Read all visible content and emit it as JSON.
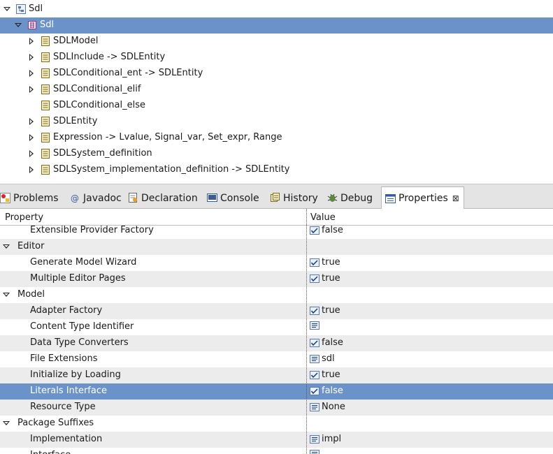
{
  "tree": {
    "items": [
      {
        "label": "Sdl",
        "icon": "genmodel-icon",
        "twisty": "open",
        "indent": 0,
        "selected": false
      },
      {
        "label": "Sdl",
        "icon": "package-icon",
        "twisty": "open",
        "indent": 1,
        "selected": true
      },
      {
        "label": "SDLModel",
        "icon": "class-icon",
        "twisty": "closed",
        "indent": 2,
        "selected": false
      },
      {
        "label": "SDLInclude -> SDLEntity",
        "icon": "class-icon",
        "twisty": "closed",
        "indent": 2,
        "selected": false
      },
      {
        "label": "SDLConditional_ent -> SDLEntity",
        "icon": "class-icon",
        "twisty": "closed",
        "indent": 2,
        "selected": false
      },
      {
        "label": "SDLConditional_elif",
        "icon": "class-icon",
        "twisty": "closed",
        "indent": 2,
        "selected": false
      },
      {
        "label": "SDLConditional_else",
        "icon": "class-icon",
        "twisty": "none",
        "indent": 2,
        "selected": false
      },
      {
        "label": "SDLEntity",
        "icon": "class-icon",
        "twisty": "closed",
        "indent": 2,
        "selected": false
      },
      {
        "label": "Expression -> Lvalue, Signal_var, Set_expr, Range",
        "icon": "class-icon",
        "twisty": "closed",
        "indent": 2,
        "selected": false
      },
      {
        "label": "SDLSystem_definition",
        "icon": "class-icon",
        "twisty": "closed",
        "indent": 2,
        "selected": false
      },
      {
        "label": "SDLSystem_implementation_definition -> SDLEntity",
        "icon": "class-icon",
        "twisty": "closed",
        "indent": 2,
        "selected": false
      }
    ]
  },
  "tabs": [
    {
      "label": "Problems",
      "icon": "problems-icon",
      "active": false
    },
    {
      "label": "Javadoc",
      "icon": "javadoc-icon",
      "active": false
    },
    {
      "label": "Declaration",
      "icon": "declaration-icon",
      "active": false
    },
    {
      "label": "Console",
      "icon": "console-icon",
      "active": false
    },
    {
      "label": "History",
      "icon": "history-icon",
      "active": false
    },
    {
      "label": "Debug",
      "icon": "debug-icon",
      "active": false
    },
    {
      "label": "Properties",
      "icon": "properties-icon",
      "active": true,
      "close": "⊠"
    }
  ],
  "properties": {
    "columns": [
      "Property",
      "Value"
    ],
    "rows": [
      {
        "kind": "prop",
        "name": "Extensible Provider Factory",
        "value": "false",
        "valueIcon": "boolean-icon"
      },
      {
        "kind": "cat",
        "name": "Editor",
        "value": ""
      },
      {
        "kind": "prop",
        "name": "Generate Model Wizard",
        "value": "true",
        "valueIcon": "boolean-icon"
      },
      {
        "kind": "prop",
        "name": "Multiple Editor Pages",
        "value": "true",
        "valueIcon": "boolean-icon"
      },
      {
        "kind": "cat",
        "name": "Model",
        "value": ""
      },
      {
        "kind": "prop",
        "name": "Adapter Factory",
        "value": "true",
        "valueIcon": "boolean-icon"
      },
      {
        "kind": "prop",
        "name": "Content Type Identifier",
        "value": "",
        "valueIcon": "text-icon"
      },
      {
        "kind": "prop",
        "name": "Data Type Converters",
        "value": "false",
        "valueIcon": "boolean-icon"
      },
      {
        "kind": "prop",
        "name": "File Extensions",
        "value": "sdl",
        "valueIcon": "text-icon"
      },
      {
        "kind": "prop",
        "name": "Initialize by Loading",
        "value": "true",
        "valueIcon": "boolean-icon"
      },
      {
        "kind": "prop",
        "name": "Literals Interface",
        "value": "false",
        "valueIcon": "boolean-icon",
        "selected": true
      },
      {
        "kind": "prop",
        "name": "Resource Type",
        "value": "None",
        "valueIcon": "text-icon"
      },
      {
        "kind": "cat",
        "name": "Package Suffixes",
        "value": ""
      },
      {
        "kind": "prop",
        "name": "Implementation",
        "value": "impl",
        "valueIcon": "text-icon"
      },
      {
        "kind": "prop",
        "name": "Interface",
        "value": "",
        "valueIcon": "text-icon"
      }
    ]
  },
  "colors": {
    "selection": "#6b93c9",
    "alt_row": "#ececec",
    "tab_bar": "#e4e4e4"
  }
}
